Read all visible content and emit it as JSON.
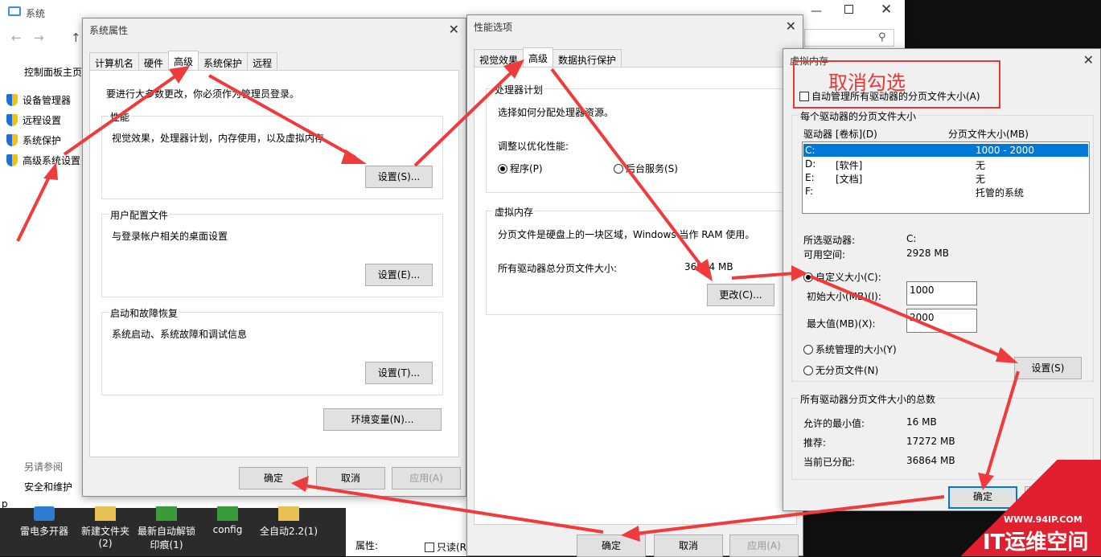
{
  "system": {
    "title": "系统",
    "nav": [
      "控制面板主页",
      "设备管理器",
      "远程设置",
      "系统保护",
      "高级系统设置"
    ],
    "see_also": "另请参阅",
    "security": "安全和维护",
    "partial_p": "p"
  },
  "props": {
    "title": "系统属性",
    "tabs": [
      "计算机名",
      "硬件",
      "高级",
      "系统保护",
      "远程"
    ],
    "admin_note": "要进行大多数更改，你必须作为管理员登录。",
    "perf_label": "性能",
    "perf_desc": "视觉效果，处理器计划，内存使用，以及虚拟内存",
    "perf_btn": "设置(S)...",
    "profile_label": "用户配置文件",
    "profile_desc": "与登录帐户相关的桌面设置",
    "profile_btn": "设置(E)...",
    "startup_label": "启动和故障恢复",
    "startup_desc": "系统启动、系统故障和调试信息",
    "startup_btn": "设置(T)...",
    "env_btn": "环境变量(N)...",
    "ok": "确定",
    "cancel": "取消",
    "apply": "应用(A)"
  },
  "perf": {
    "title": "性能选项",
    "tabs": [
      "视觉效果",
      "高级",
      "数据执行保护"
    ],
    "sched_label": "处理器计划",
    "sched_desc": "选择如何分配处理器资源。",
    "optimize": "调整以优化性能:",
    "programs": "程序(P)",
    "services": "后台服务(S)",
    "vm_label": "虚拟内存",
    "vm_desc": "分页文件是硬盘上的一块区域，Windows 当作 RAM 使用。",
    "total_label": "所有驱动器总分页文件大小:",
    "total_value": "36864 MB",
    "change_btn": "更改(C)...",
    "ok": "确定",
    "cancel": "取消",
    "apply": "应用(A)"
  },
  "vmem": {
    "title": "虚拟内存",
    "annotation": "取消勾选",
    "auto_manage": "自动管理所有驱动器的分页文件大小(A)",
    "per_drive": "每个驱动器的分页文件大小",
    "col_drive": "驱动器 [卷标](D)",
    "col_size": "分页文件大小(MB)",
    "drives": [
      {
        "drive": "C:",
        "label": "",
        "size": "1000 - 2000"
      },
      {
        "drive": "D:",
        "label": "[软件]",
        "size": "无"
      },
      {
        "drive": "E:",
        "label": "[文档]",
        "size": "无"
      },
      {
        "drive": "F:",
        "label": "",
        "size": "托管的系统"
      }
    ],
    "sel_drive_label": "所选驱动器:",
    "sel_drive_value": "C:",
    "free_label": "可用空间:",
    "free_value": "2928 MB",
    "custom": "自定义大小(C):",
    "initial_label": "初始大小(MB)(I):",
    "initial_value": "1000",
    "max_label": "最大值(MB)(X):",
    "max_value": "2000",
    "system_managed": "系统管理的大小(Y)",
    "no_paging": "无分页文件(N)",
    "set_btn": "设置(S)",
    "totals_label": "所有驱动器分页文件大小的总数",
    "min_label": "允许的最小值:",
    "min_value": "16 MB",
    "rec_label": "推荐:",
    "rec_value": "17272 MB",
    "cur_label": "当前已分配:",
    "cur_value": "36864 MB",
    "ok": "确定"
  },
  "desktop": {
    "items": [
      "雷电多开器",
      "新建文件夹\n(2)",
      "最新自动解锁\n印痕(1)",
      "config",
      "全自动2.2(1)"
    ],
    "attr_label": "属性:",
    "readonly": "只读(R"
  },
  "watermark": {
    "url": "WWW.94IP.COM",
    "brand": "IT运维空间"
  },
  "colors": {
    "arrow": "#ef3b3b",
    "selection": "#0078d7",
    "annotation_box": "#e53935"
  }
}
